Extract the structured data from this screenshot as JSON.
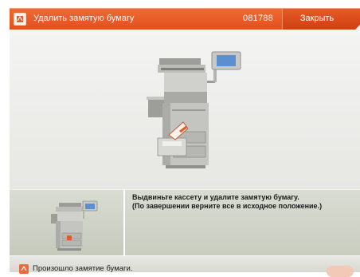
{
  "header": {
    "title": "Удалить замятую бумагу",
    "code": "081788",
    "close_label": "Закрыть",
    "icon": "paper-jam-icon"
  },
  "instruction": {
    "line1": "Выдвиньте кассету и удалите замятую бумагу.",
    "line2": "(По завершении верните все в исходное положение.)"
  },
  "status": {
    "message": "Произошло замятие бумаги.",
    "icon": "error-icon"
  },
  "colors": {
    "accent": "#e9582a",
    "panel": "#cfd2c6",
    "background": "#eeeeec"
  }
}
